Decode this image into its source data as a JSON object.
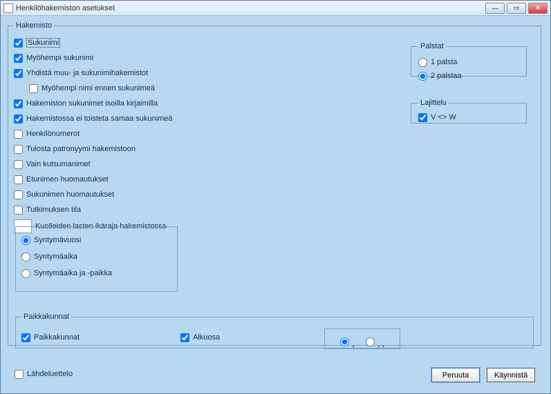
{
  "window": {
    "title": "Henkilöhakemiston asetukset"
  },
  "groups": {
    "hakemisto": "Hakemisto",
    "palstat": "Palstat",
    "lajittelu": "Lajittelu",
    "paikkakunnat": "Paikkakunnat"
  },
  "checks": {
    "sukunimi": "Sukunimi",
    "myohempi": "Myöhempi sukunimi",
    "yhdista": "Yhdistä muu- ja sukunimihakemistot",
    "myohempi_ennen": "Myöhempi nimi ennen sukunimeä",
    "isoilla": "Hakemiston sukunimet isoilla kirjaimilla",
    "ei_toisteta": "Hakemistossa ei toisteta samaa sukunimeä",
    "henkilonumerot": "Henkilönumerot",
    "patronyymi": "Tulosta patronyymi hakemistoon",
    "kutsumanimet": "Vain kutsumanimet",
    "etunimen": "Etunimen huomautukset",
    "sukunimen": "Sukunimen huomautukset",
    "tutkimuksen": "Tutkimuksen tila",
    "kuolleiden": "Kuolleiden lasten ikäraja hakemistossa",
    "paikkakunnat": "Paikkakunnat",
    "alkuosa": "Alkuosa",
    "lahdeluettelo": "Lähdeluettelo",
    "vw": "V <> W"
  },
  "radios": {
    "palsta1": "1 palsta",
    "palsta2": "2 palstaa",
    "syntymavuosi": "Syntymävuosi",
    "syntymaaika": "Syntymäaika",
    "syntymaaika_paikka": "Syntymäaika ja -paikka",
    "sep1": ",",
    "sep2": ", ,"
  },
  "buttons": {
    "peruuta": "Peruuta",
    "kaynnista": "Käynnistä"
  }
}
